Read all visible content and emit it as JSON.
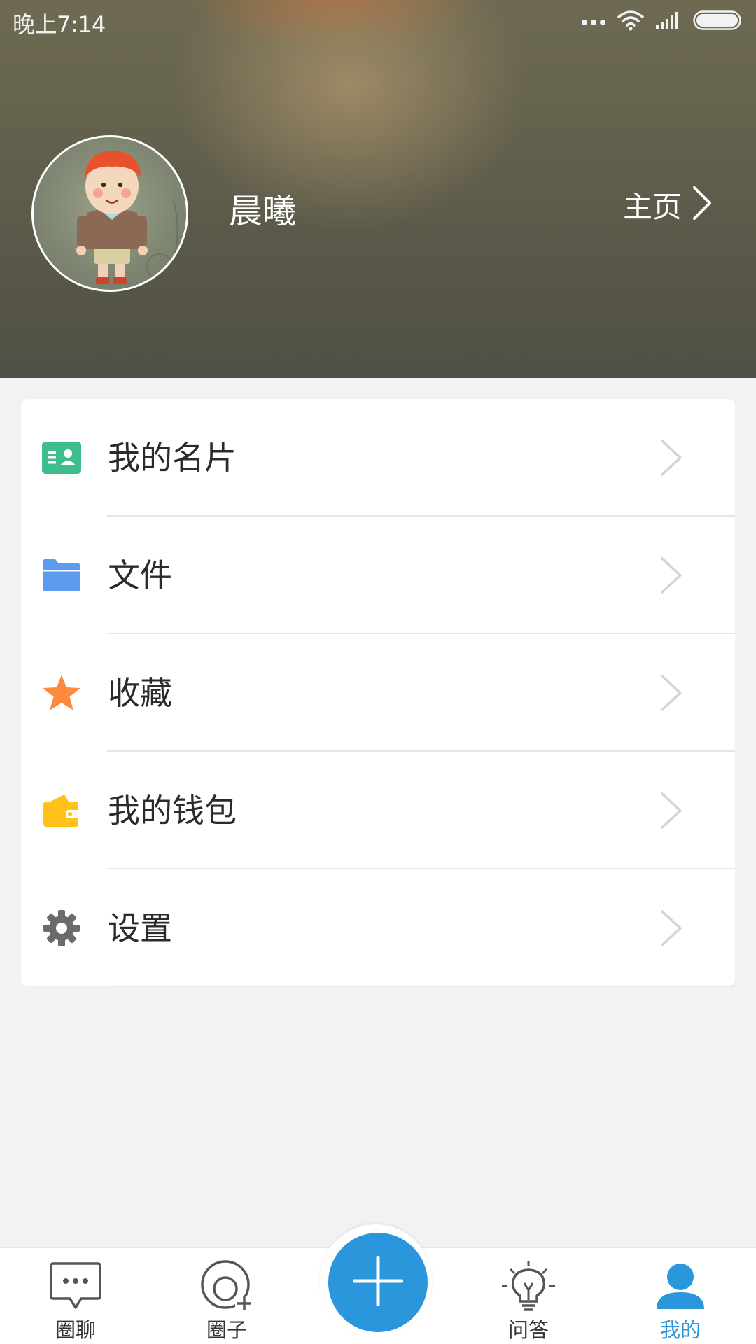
{
  "status_bar": {
    "time": "晚上7:14",
    "icons": [
      "more-dots-icon",
      "wifi-icon",
      "signal-icon",
      "battery-icon"
    ]
  },
  "profile": {
    "name": "晨曦",
    "homepage_label": "主页",
    "avatar_icon": "avatar-cartoon-boy"
  },
  "menu": {
    "items": [
      {
        "label": "我的名片",
        "icon": "business-card-icon",
        "color": "#3fbe8d"
      },
      {
        "label": "文件",
        "icon": "folder-icon",
        "color": "#5b9cf0"
      },
      {
        "label": "收藏",
        "icon": "star-icon",
        "color": "#ff8a3d"
      },
      {
        "label": "我的钱包",
        "icon": "wallet-icon",
        "color": "#ffc21a"
      },
      {
        "label": "设置",
        "icon": "gear-icon",
        "color": "#6b6b6b"
      }
    ]
  },
  "tab_bar": {
    "tabs": [
      {
        "label": "圈聊",
        "icon": "chat-bubble-icon",
        "active": false
      },
      {
        "label": "圈子",
        "icon": "circle-add-icon",
        "active": false
      },
      {
        "label": "问答",
        "icon": "lightbulb-icon",
        "active": false
      },
      {
        "label": "我的",
        "icon": "person-icon",
        "active": true
      }
    ],
    "center_action_icon": "plus-icon"
  },
  "colors": {
    "accent": "#2a96dc",
    "background": "#f2f2f2"
  }
}
